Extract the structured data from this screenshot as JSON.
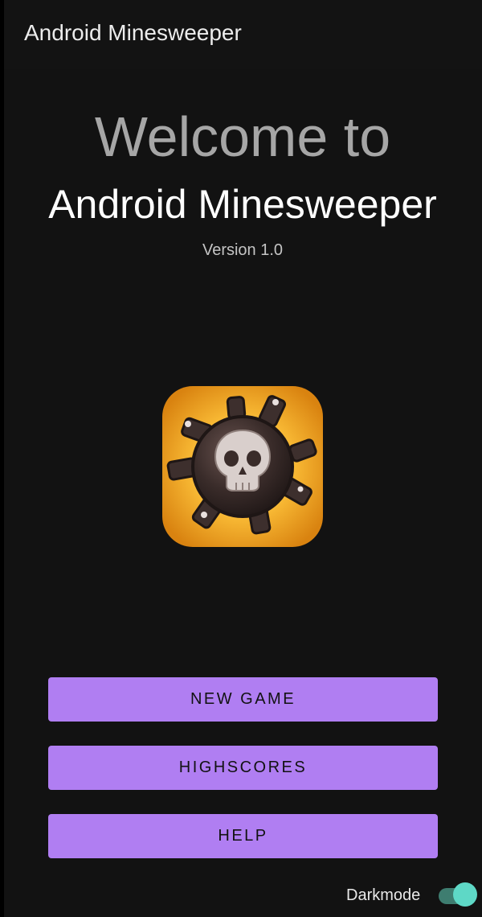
{
  "app_bar": {
    "title": "Android Minesweeper"
  },
  "hero": {
    "welcome": "Welcome to",
    "app_name": "Android Minesweeper",
    "version": "Version 1.0"
  },
  "logo": {
    "icon": "mine-skull-icon"
  },
  "buttons": {
    "new_game": "NEW GAME",
    "highscores": "HIGHSCORES",
    "help": "HELP"
  },
  "settings": {
    "darkmode_label": "Darkmode",
    "darkmode_on": true
  },
  "colors": {
    "background": "#121212",
    "button": "#b07ef2",
    "switch_thumb": "#5ed8c6",
    "switch_track": "#3e7d70"
  }
}
